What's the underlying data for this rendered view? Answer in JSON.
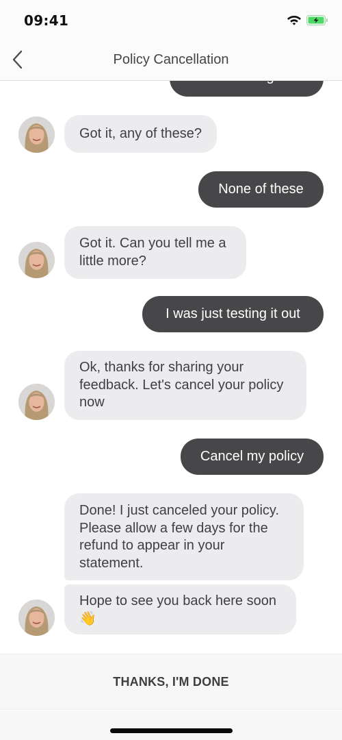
{
  "status_bar": {
    "time": "09:41",
    "icons": [
      "wifi-icon",
      "battery-charging-icon"
    ],
    "battery_color": "#4cd964"
  },
  "nav": {
    "title": "Policy Cancellation",
    "back_icon": "chevron-left-icon"
  },
  "messages": [
    {
      "sender": "user",
      "text": "It's something else",
      "partially_visible": true
    },
    {
      "sender": "bot",
      "text": "Got it, any of these?"
    },
    {
      "sender": "user",
      "text": "None of these"
    },
    {
      "sender": "bot",
      "text": "Got it. Can you tell me a little more?"
    },
    {
      "sender": "user",
      "text": "I was just testing it out"
    },
    {
      "sender": "bot",
      "text": "Ok, thanks for sharing your feedback. Let's cancel your policy now"
    },
    {
      "sender": "user",
      "text": "Cancel my policy"
    },
    {
      "sender": "bot",
      "text": "Done! I just canceled your policy. Please allow a few days for the refund to appear in your statement."
    },
    {
      "sender": "bot",
      "text": "Hope to see you back here soon 👋"
    }
  ],
  "footer": {
    "button_label": "THANKS, I'M DONE"
  },
  "colors": {
    "bot_bubble": "#ececee",
    "user_bubble": "#47474a",
    "user_text": "#ffffff",
    "bot_text": "#3f3f42"
  }
}
